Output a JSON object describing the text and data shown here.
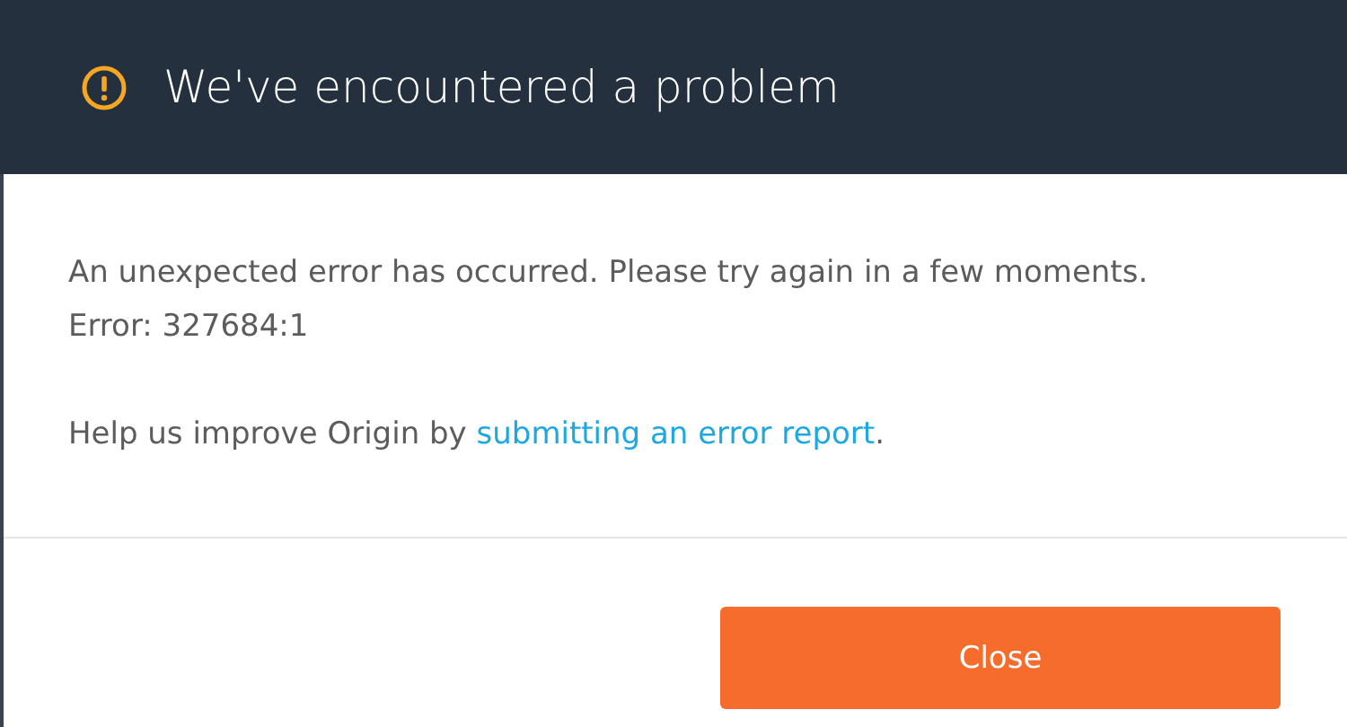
{
  "header": {
    "title": "We've encountered a problem"
  },
  "message": {
    "lines": [
      "An unexpected error has occurred. Please try again in a few moments.",
      "Error: 327684:1"
    ]
  },
  "help": {
    "before": "Help us improve Origin by ",
    "link": "submitting an error report",
    "after": "."
  },
  "buttons": [
    "Close"
  ]
}
